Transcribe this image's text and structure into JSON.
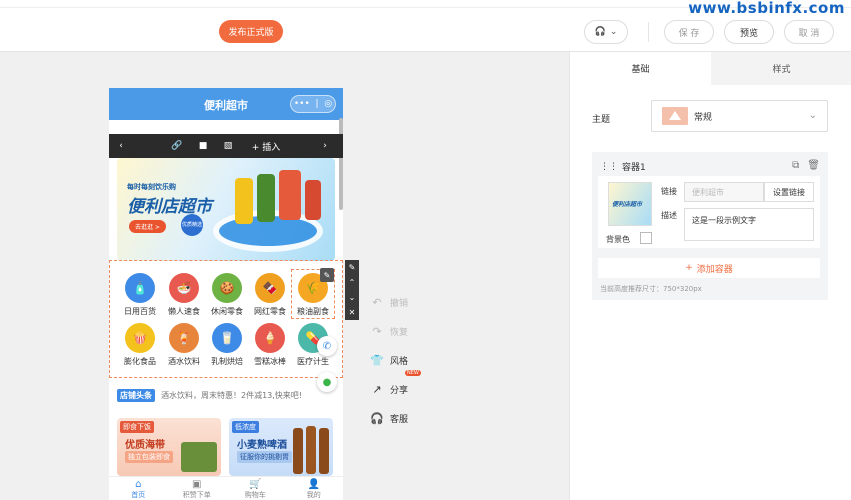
{
  "watermark": "www.bsbinfx.com",
  "topbar": {
    "publish_label": "发布正式版",
    "save_label": "保 存",
    "preview_label": "预览",
    "cancel_label": "取 消"
  },
  "phone": {
    "title": "便利超市",
    "capsule_dots": "•••",
    "toolbar": {
      "prev": "‹",
      "insert_label": "+ 插入",
      "next": "›"
    },
    "banner": {
      "slogan": "每时每刻饮乐购",
      "headline": "便利店超市",
      "pill": "去逛逛 >",
      "badge": "优质精选"
    },
    "categories": [
      {
        "label": "日用百货",
        "color": "#3d8be6",
        "icon": "🧴"
      },
      {
        "label": "懒人速食",
        "color": "#e85a4f",
        "icon": "🍜"
      },
      {
        "label": "休闲零食",
        "color": "#6fb244",
        "icon": "🍪"
      },
      {
        "label": "网红零食",
        "color": "#f0a020",
        "icon": "🍫"
      },
      {
        "label": "粮油副食",
        "color": "#f5a623",
        "icon": "🌾"
      },
      {
        "label": "膨化食品",
        "color": "#f3c21c",
        "icon": "🍿"
      },
      {
        "label": "酒水饮料",
        "color": "#e8853d",
        "icon": "🍹"
      },
      {
        "label": "乳制烘焙",
        "color": "#3d8be6",
        "icon": "🥛"
      },
      {
        "label": "雪糕冰棒",
        "color": "#e85a4f",
        "icon": "🍦"
      },
      {
        "label": "医疗计生",
        "color": "#4bb8a9",
        "icon": "💊"
      }
    ],
    "notice": {
      "tag": "店铺头条",
      "text": "酒水饮料，周末特惠！2件减13,快来吧!"
    },
    "promos": [
      {
        "tag": "即食下饭",
        "title": "优质海带",
        "sub": "独立包装即食"
      },
      {
        "tag": "低浓度",
        "title": "小麦熟啤酒",
        "sub": "征服你的挑剔胃"
      }
    ],
    "tabs": [
      {
        "label": "首页",
        "icon": "⌂"
      },
      {
        "label": "积赞下单",
        "icon": "▣"
      },
      {
        "label": "购物车",
        "icon": "🛒"
      },
      {
        "label": "我的",
        "icon": "👤"
      }
    ]
  },
  "actions": [
    {
      "label": "撤销",
      "icon": "↶",
      "enabled": false
    },
    {
      "label": "恢复",
      "icon": "↷",
      "enabled": false
    },
    {
      "label": "风格",
      "icon": "👕",
      "enabled": true
    },
    {
      "label": "分享",
      "icon": "↗",
      "enabled": true,
      "badge": "NEW"
    },
    {
      "label": "客服",
      "icon": "🎧",
      "enabled": true
    }
  ],
  "panel": {
    "tab_basic": "基础",
    "tab_style": "样式",
    "theme_label": "主题",
    "theme_value": "常规",
    "container": {
      "title": "容器1",
      "link_label": "链接",
      "link_placeholder": "便利超市",
      "set_link_label": "设置链接",
      "desc_label": "描述",
      "desc_value": "这是一段示例文字",
      "bg_label": "背景色",
      "thumb_text": "便利店超市",
      "add_label": "添加容器",
      "hint": "当前高度推荐尺寸：750*320px"
    }
  }
}
